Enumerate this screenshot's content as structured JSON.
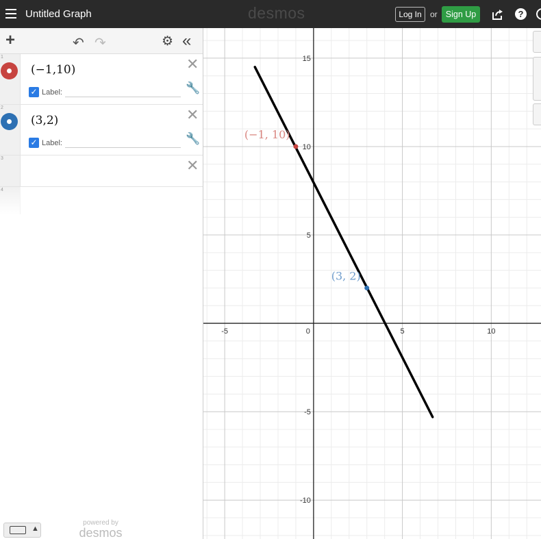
{
  "header": {
    "title": "Untitled Graph",
    "brand": "desmos",
    "login_label": "Log In",
    "or_label": "or",
    "signup_label": "Sign Up",
    "help_label": "?",
    "colors": {
      "bar": "#2a2a2a",
      "signup": "#2f9c44"
    }
  },
  "toolbar": {
    "icons": [
      "add-icon",
      "undo-icon",
      "redo-icon",
      "gear-icon",
      "collapse-icon"
    ],
    "add_glyph": "+",
    "undo_glyph": "↶",
    "redo_glyph": "↷",
    "gear_glyph": "⚙",
    "collapse_glyph": "«"
  },
  "expressions": [
    {
      "number": "1",
      "latex": "(−1,10)",
      "color": "#c74440",
      "label_checked": true,
      "label_text": "Label:",
      "close_glyph": "✕",
      "wrench_glyph": "🔧"
    },
    {
      "number": "2",
      "latex": "(3,2)",
      "color": "#2d70b3",
      "label_checked": true,
      "label_text": "Label:",
      "close_glyph": "✕",
      "wrench_glyph": "🔧"
    },
    {
      "number": "3",
      "latex": "",
      "close_glyph": "✕"
    },
    {
      "number": "4",
      "latex": ""
    }
  ],
  "footer": {
    "keyboard_arrow": "▲",
    "powered_by": "powered by",
    "brand": "desmos"
  },
  "graph": {
    "x_ticks": [
      "-5",
      "0",
      "5",
      "10"
    ],
    "y_ticks": [
      "15",
      "10",
      "5",
      "-5",
      "-10"
    ],
    "point_labels": [
      "(−1, 10)",
      "(3, 2)"
    ],
    "line_endpoints": [
      [
        -3.3,
        14.5
      ],
      [
        6.7,
        -5.3
      ]
    ],
    "x_range": [
      -6.2,
      12.8
    ],
    "y_range": [
      -12.2,
      16.7
    ],
    "grid": true
  }
}
